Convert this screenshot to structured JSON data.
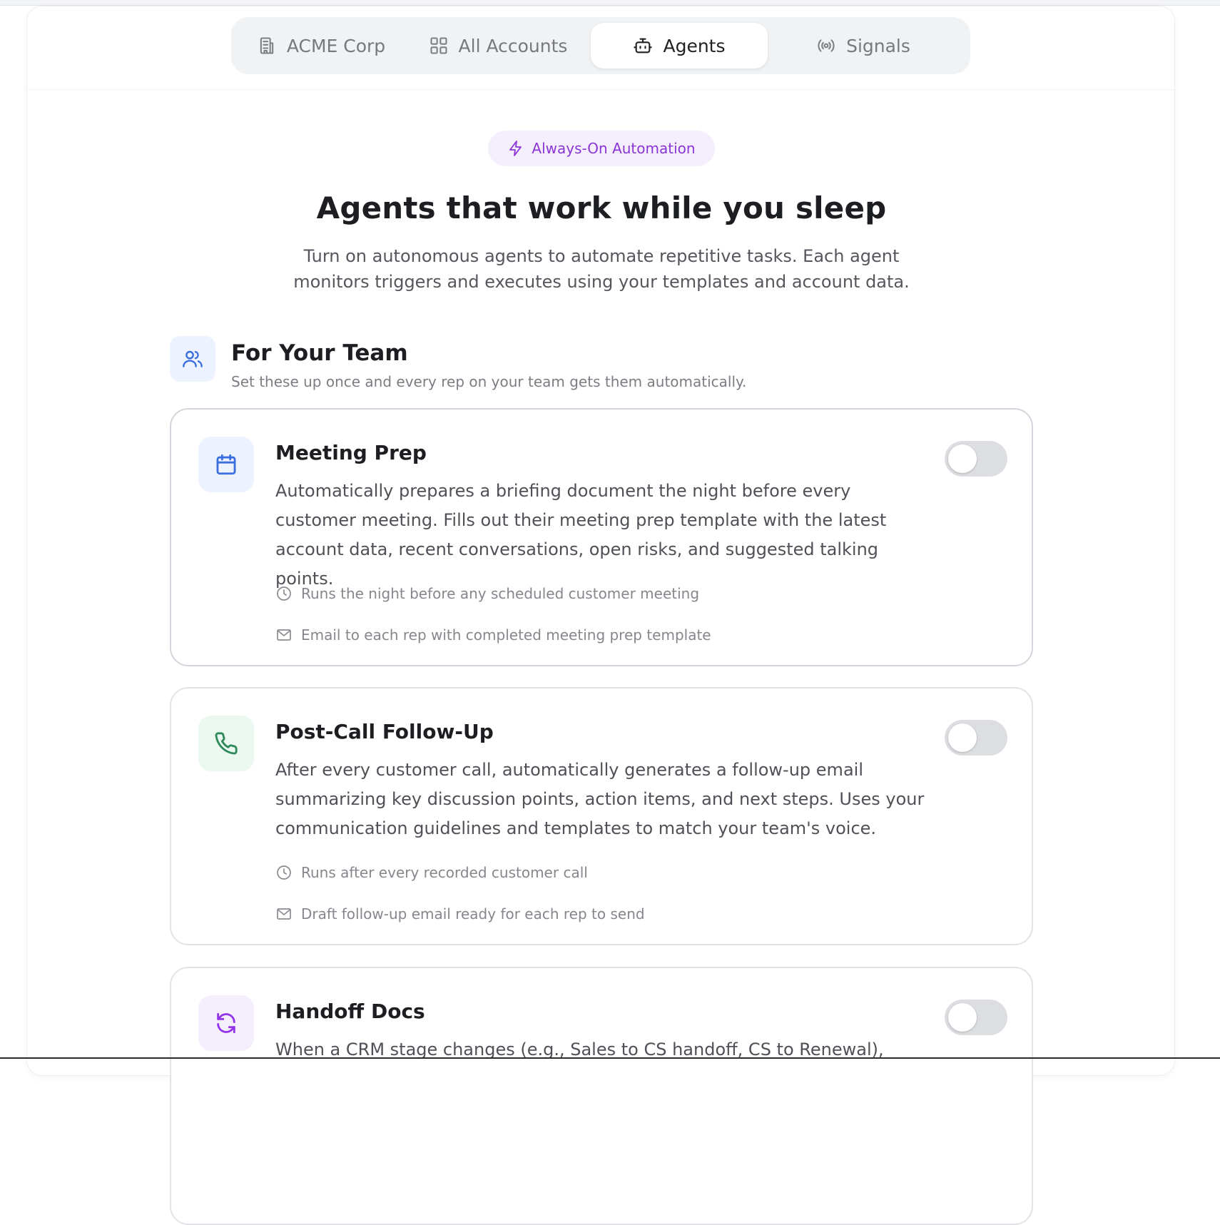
{
  "tabs": [
    {
      "label": "ACME Corp",
      "icon": "building-icon",
      "active": false
    },
    {
      "label": "All Accounts",
      "icon": "grid-icon",
      "active": false
    },
    {
      "label": "Agents",
      "icon": "bot-icon",
      "active": true
    },
    {
      "label": "Signals",
      "icon": "radio-signal-icon",
      "active": false
    }
  ],
  "hero": {
    "badge": "Always-On Automation",
    "badge_icon": "lightning-icon",
    "title": "Agents that work while you sleep",
    "subtitle": "Turn on autonomous agents to automate repetitive tasks. Each agent monitors triggers and executes using your templates and account data."
  },
  "team_section": {
    "icon": "users-icon",
    "title": "For Your Team",
    "subtitle": "Set these up once and every rep on your team gets them automatically."
  },
  "agents": [
    {
      "title": "Meeting Prep",
      "icon": "calendar-icon",
      "icon_color": "#3b6fe0",
      "icon_bg": "#edf3fe",
      "description": "Automatically prepares a briefing document the night before every customer meeting. Fills out their meeting prep template with the latest account data, recent conversations, open risks, and suggested talking points.",
      "trigger": "Runs the night before any scheduled customer meeting",
      "output": "Email to each rep with completed meeting prep template",
      "enabled": false
    },
    {
      "title": "Post-Call Follow-Up",
      "icon": "phone-icon",
      "icon_color": "#2f8a5b",
      "icon_bg": "#eaf8f0",
      "description": "After every customer call, automatically generates a follow-up email summarizing key discussion points, action items, and next steps. Uses your communication guidelines and templates to match your team's voice.",
      "trigger": "Runs after every recorded customer call",
      "output": "Draft follow-up email ready for each rep to send",
      "enabled": false
    },
    {
      "title": "Handoff Docs",
      "icon": "refresh-icon",
      "icon_color": "#9333ea",
      "icon_bg": "#f5effd",
      "description": "When a CRM stage changes (e.g., Sales to CS handoff, CS to Renewal),",
      "enabled": false
    }
  ],
  "colors": {
    "accent_purple": "#8b35d6",
    "active_tab_bg": "#ffffff",
    "tab_bar_bg": "#f1f2f4",
    "toggle_off": "#dcdee2"
  }
}
